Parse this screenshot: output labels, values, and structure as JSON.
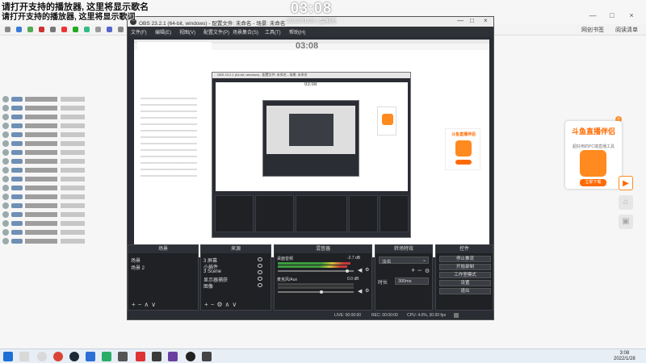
{
  "overlay": {
    "song_name_line": "请打开支持的播放器, 这里将显示歌名",
    "lyrics_line": "请打开支持的播放器, 这里将显示歌词",
    "clock": "03:08",
    "date": "2022/01/28 | 星期五"
  },
  "browser": {
    "bookmark_right_1": "网创书签",
    "bookmark_right_2": "阅读清单"
  },
  "promo": {
    "title": "斗鱼直播伴侣",
    "subtitle": "超好用的PC端直播工具",
    "button": "立即下载",
    "close": "×"
  },
  "obs": {
    "title": "OBS 23.2.1 (64-bit, windows) - 配置文件: 未命名 - 场景: 未命名",
    "menu": [
      "文件(F)",
      "编辑(E)",
      "视图(V)",
      "配置文件(P)",
      "场景集合(S)",
      "工具(T)",
      "帮助(H)"
    ],
    "docks": {
      "scenes": {
        "header": "场景",
        "items": [
          "场景",
          "场景 2"
        ]
      },
      "sources": {
        "header": "来源",
        "items": [
          "3 屏幕",
          "小插件",
          "3 Scene",
          "显示器捕获",
          "图像"
        ]
      },
      "mixer": {
        "header": "混音器",
        "channels": [
          {
            "name": "桌面音频",
            "db": "-2.7 dB"
          },
          {
            "name": "麦克风/Aux",
            "db": "0.0 dB"
          }
        ]
      },
      "transitions": {
        "header": "转场特效",
        "type": "淡出",
        "duration_label": "时长",
        "duration_value": "300ms"
      },
      "controls": {
        "header": "控件",
        "buttons": [
          "停止推流",
          "开始录制",
          "工作室模式",
          "设置",
          "退出"
        ]
      }
    },
    "status": {
      "live": "LIVE: 00:00:00",
      "rec": "REC: 00:00:00",
      "cpu": "CPU: 4.0%, 30.00 fps"
    },
    "nested": {
      "title": "OBS 23.2.1 (64-bit, windows) - 配置文件: 未命名 - 场景: 未命名"
    }
  },
  "taskbar": {
    "time": "3:08",
    "date": "2022/1/28"
  }
}
